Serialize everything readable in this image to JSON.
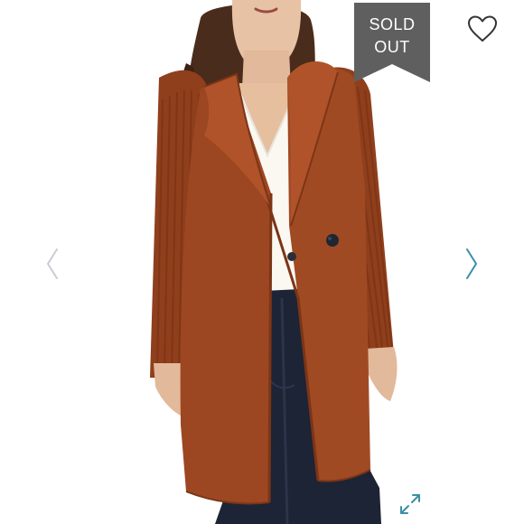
{
  "listing": {
    "status_banner": {
      "line1": "SOLD",
      "line2": "OUT",
      "color": "#5f5f5f"
    },
    "colors": {
      "accent": "#3d8ea6",
      "nav_inactive": "#c8cdd2",
      "coat": "#9c4722",
      "knit": "#8f3f1c",
      "blouse": "#fbf8f2",
      "jeans": "#1d2435",
      "hair": "#4a2c1c",
      "skin": "#e5bfa2"
    },
    "icons": {
      "like": "heart-outline-icon",
      "prev": "chevron-left-icon",
      "next": "chevron-right-icon",
      "expand": "expand-arrows-icon"
    }
  }
}
